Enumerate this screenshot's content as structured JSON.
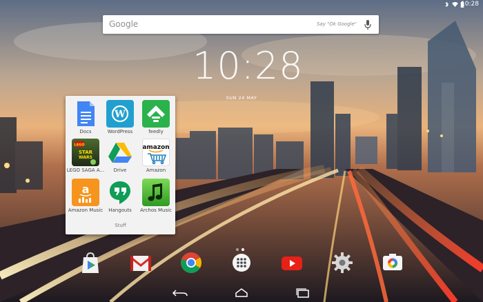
{
  "status_bar": {
    "time": "10:28",
    "icons": [
      "bluetooth-icon",
      "wifi-icon",
      "battery-icon"
    ]
  },
  "search": {
    "logo": "Google",
    "hint": "Say \"Ok Google\"",
    "icon": "mic-icon"
  },
  "clock": {
    "time": "10:28",
    "date": "SUN 24 MAY"
  },
  "folder": {
    "name": "Stuff",
    "apps": [
      {
        "label": "Docs",
        "icon": "docs-icon"
      },
      {
        "label": "WordPress",
        "icon": "wordpress-icon"
      },
      {
        "label": "feedly",
        "icon": "feedly-icon"
      },
      {
        "label": "LEGO SAGA A...",
        "icon": "lego-star-wars-icon",
        "tile_text": "LEGO STAR WARS"
      },
      {
        "label": "Drive",
        "icon": "drive-icon"
      },
      {
        "label": "Amazon",
        "icon": "amazon-icon",
        "tile_text": "amazon"
      },
      {
        "label": "Amazon Music",
        "icon": "amazon-music-icon"
      },
      {
        "label": "Hangouts",
        "icon": "hangouts-icon"
      },
      {
        "label": "Archos Music",
        "icon": "archos-music-icon"
      }
    ]
  },
  "dock": [
    "play-store-icon",
    "gmail-icon",
    "chrome-icon",
    "app-drawer-icon",
    "youtube-icon",
    "settings-icon",
    "camera-icon"
  ],
  "nav": [
    "back-icon",
    "home-icon",
    "recents-icon"
  ],
  "colors": {
    "accent": "#4285f4",
    "folder_bg": "#f2f2f2"
  }
}
